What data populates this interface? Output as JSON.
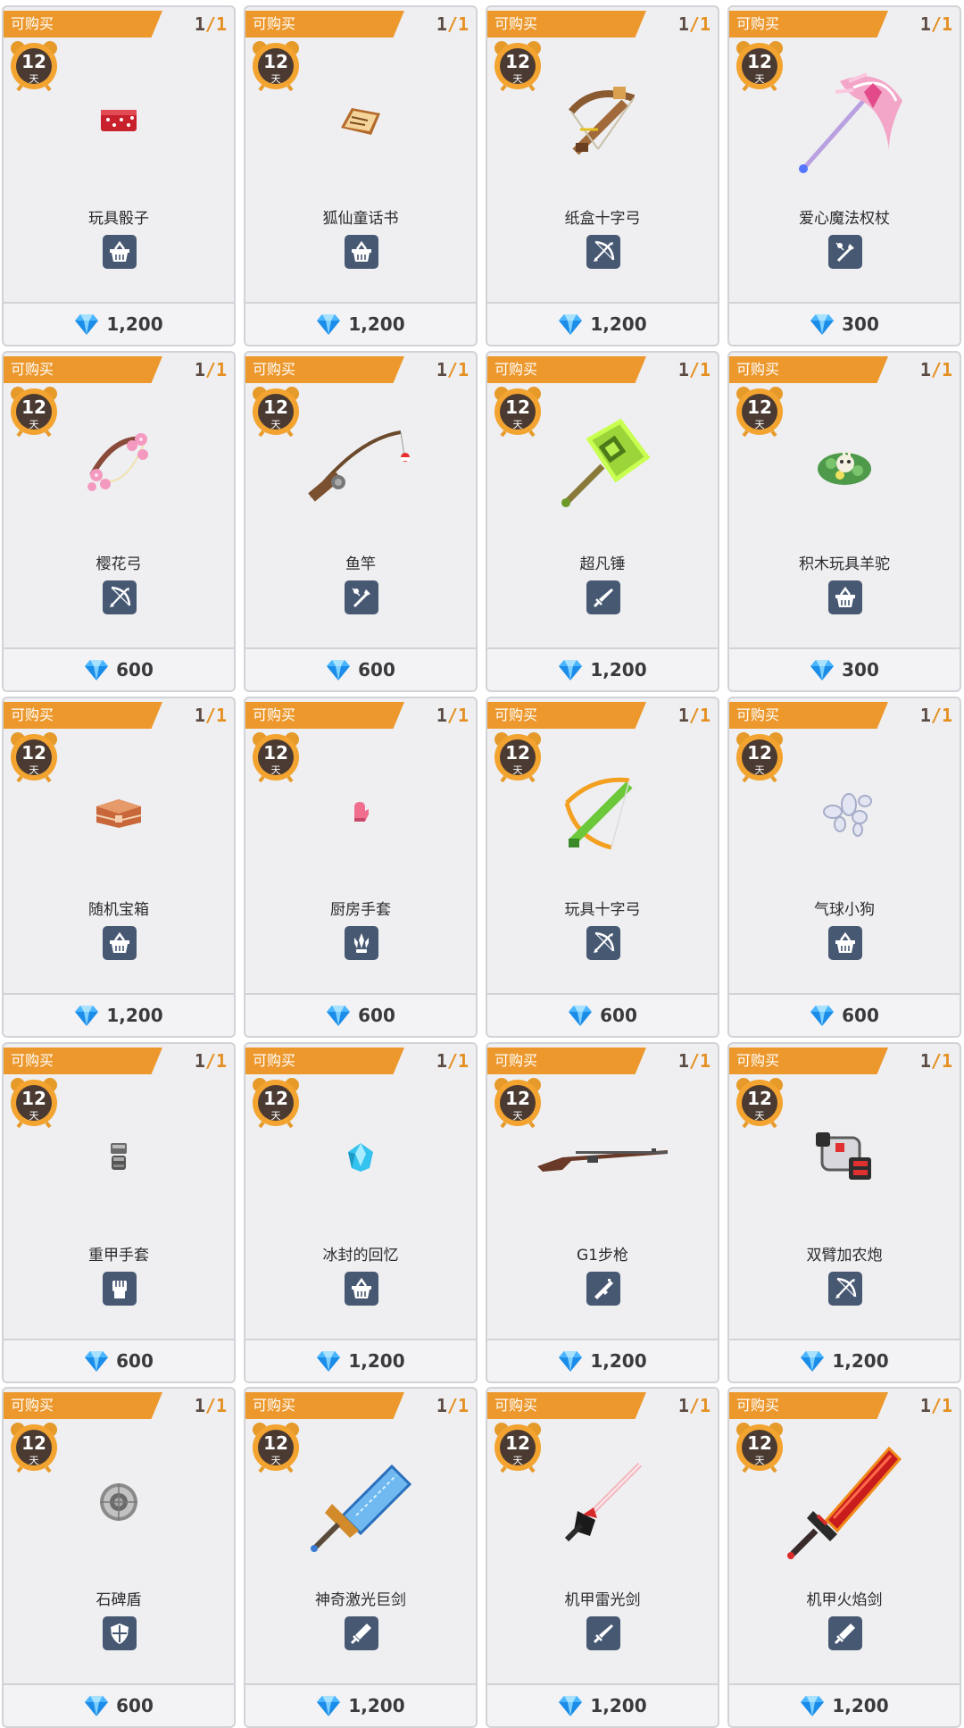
{
  "labels": {
    "badge": "可购买",
    "days_unit": "天"
  },
  "items": [
    {
      "name": "玩具骰子",
      "days": "12",
      "stock_current": "1",
      "stock_max": "/1",
      "price": "1,200",
      "category": "basket-icon",
      "art": "dice"
    },
    {
      "name": "狐仙童话书",
      "days": "12",
      "stock_current": "1",
      "stock_max": "/1",
      "price": "1,200",
      "category": "basket-icon",
      "art": "book"
    },
    {
      "name": "纸盒十字弓",
      "days": "12",
      "stock_current": "1",
      "stock_max": "/1",
      "price": "1,200",
      "category": "bow-icon",
      "art": "crossbow"
    },
    {
      "name": "爱心魔法权杖",
      "days": "12",
      "stock_current": "1",
      "stock_max": "/1",
      "price": "300",
      "category": "staff-icon",
      "art": "scythe"
    },
    {
      "name": "樱花弓",
      "days": "12",
      "stock_current": "1",
      "stock_max": "/1",
      "price": "600",
      "category": "bow-icon",
      "art": "pinkbow"
    },
    {
      "name": "鱼竿",
      "days": "12",
      "stock_current": "1",
      "stock_max": "/1",
      "price": "600",
      "category": "staff-icon",
      "art": "rod"
    },
    {
      "name": "超凡锤",
      "days": "12",
      "stock_current": "1",
      "stock_max": "/1",
      "price": "1,200",
      "category": "sword-icon",
      "art": "hammer"
    },
    {
      "name": "积木玩具羊驼",
      "days": "12",
      "stock_current": "1",
      "stock_max": "/1",
      "price": "300",
      "category": "basket-icon",
      "art": "alpaca"
    },
    {
      "name": "随机宝箱",
      "days": "12",
      "stock_current": "1",
      "stock_max": "/1",
      "price": "1,200",
      "category": "basket-icon",
      "art": "chest"
    },
    {
      "name": "厨房手套",
      "days": "12",
      "stock_current": "1",
      "stock_max": "/1",
      "price": "600",
      "category": "claw-icon",
      "art": "mitt"
    },
    {
      "name": "玩具十字弓",
      "days": "12",
      "stock_current": "1",
      "stock_max": "/1",
      "price": "600",
      "category": "bow-icon",
      "art": "greenbow"
    },
    {
      "name": "气球小狗",
      "days": "12",
      "stock_current": "1",
      "stock_max": "/1",
      "price": "600",
      "category": "basket-icon",
      "art": "balloon"
    },
    {
      "name": "重甲手套",
      "days": "12",
      "stock_current": "1",
      "stock_max": "/1",
      "price": "600",
      "category": "fist-icon",
      "art": "gauntlet"
    },
    {
      "name": "冰封的回忆",
      "days": "12",
      "stock_current": "1",
      "stock_max": "/1",
      "price": "1,200",
      "category": "basket-icon",
      "art": "crystal"
    },
    {
      "name": "G1步枪",
      "days": "12",
      "stock_current": "1",
      "stock_max": "/1",
      "price": "1,200",
      "category": "gun-icon",
      "art": "rifle"
    },
    {
      "name": "双臂加农炮",
      "days": "12",
      "stock_current": "1",
      "stock_max": "/1",
      "price": "1,200",
      "category": "bow-icon",
      "art": "cannon"
    },
    {
      "name": "石碑盾",
      "days": "12",
      "stock_current": "1",
      "stock_max": "/1",
      "price": "600",
      "category": "shield-icon",
      "art": "shield"
    },
    {
      "name": "神奇激光巨剑",
      "days": "12",
      "stock_current": "1",
      "stock_max": "/1",
      "price": "1,200",
      "category": "greatsword-icon",
      "art": "lasersword"
    },
    {
      "name": "机甲雷光剑",
      "days": "12",
      "stock_current": "1",
      "stock_max": "/1",
      "price": "1,200",
      "category": "sword-icon",
      "art": "mechsaber"
    },
    {
      "name": "机甲火焰剑",
      "days": "12",
      "stock_current": "1",
      "stock_max": "/1",
      "price": "1,200",
      "category": "greatsword-icon",
      "art": "firesword"
    }
  ]
}
